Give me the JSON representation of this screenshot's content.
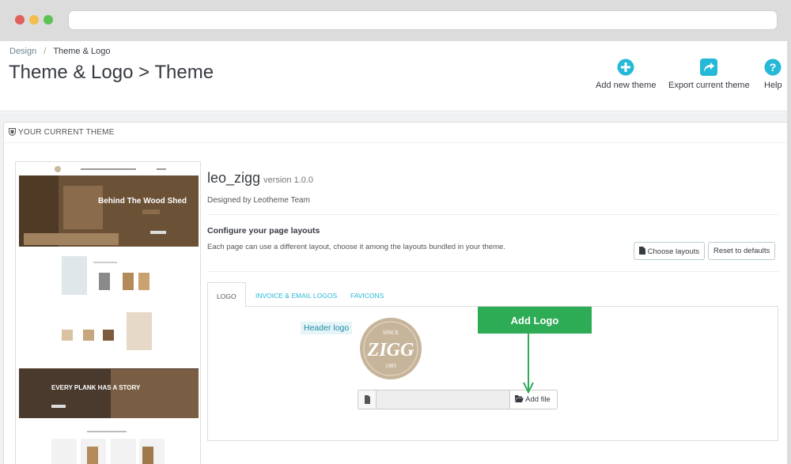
{
  "breadcrumb": {
    "parent": "Design",
    "current": "Theme & Logo"
  },
  "page_title": "Theme & Logo > Theme",
  "toolbar": {
    "add_theme": "Add new theme",
    "export_theme": "Export current theme",
    "help": "Help"
  },
  "panel_title": "YOUR CURRENT THEME",
  "preview": {
    "hero1": "Behind The Wood Shed",
    "hero2": "EVERY PLANK HAS A STORY"
  },
  "theme": {
    "name": "leo_zigg",
    "version": "version 1.0.0",
    "designed_by": "Designed by Leotheme Team"
  },
  "layouts": {
    "heading": "Configure your page layouts",
    "description": "Each page can use a different layout, choose it among the layouts bundled in your theme.",
    "choose_label": "Choose layouts",
    "reset_label": "Reset to defaults"
  },
  "tabs": {
    "logo": "LOGO",
    "invoice": "INVOICE & EMAIL LOGOS",
    "favicons": "FAVICONS"
  },
  "logo_tab": {
    "header_logo_label": "Header logo",
    "add_file_label": "Add file"
  },
  "logo_text": {
    "since": "SINCE",
    "brand": "ZIGG",
    "year": "1985"
  },
  "callout": {
    "label": "Add Logo"
  },
  "colors": {
    "accent": "#25b9d7",
    "callout": "#2eab55"
  }
}
